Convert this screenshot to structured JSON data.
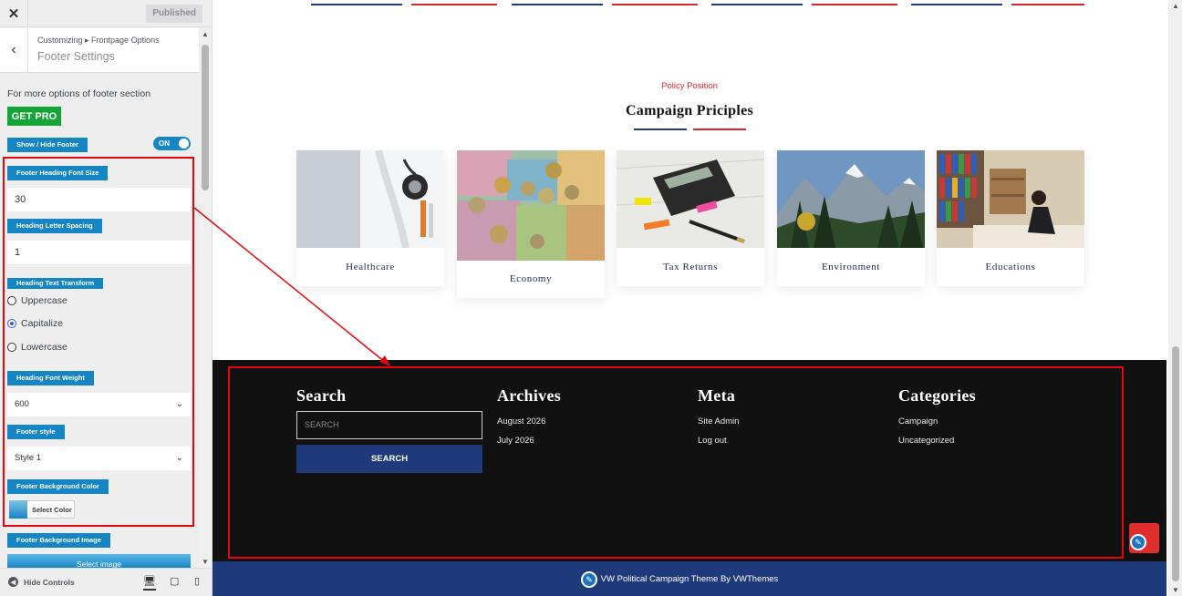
{
  "customizer": {
    "published_label": "Published",
    "breadcrumb": "Customizing ▸ Frontpage Options",
    "section_title": "Footer Settings",
    "more_options_text": "For more options of footer section",
    "get_pro_label": "GET PRO",
    "show_hide_label": "Show / Hide Footer",
    "toggle_label": "ON",
    "heading_font_size_label": "Footer Heading Font Size",
    "heading_font_size_value": "30",
    "letter_spacing_label": "Heading Letter Spacing",
    "letter_spacing_value": "1",
    "text_transform_label": "Heading Text Transform",
    "text_transform_options": [
      "Uppercase",
      "Capitalize",
      "Lowercase"
    ],
    "text_transform_selected": "Capitalize",
    "font_weight_label": "Heading Font Weight",
    "font_weight_value": "600",
    "footer_style_label": "Footer style",
    "footer_style_value": "Style 1",
    "bg_color_label": "Footer Background Color",
    "select_color_label": "Select Color",
    "bg_image_label": "Footer Background Image",
    "select_image_label": "Select image",
    "hide_controls_label": "Hide Controls"
  },
  "preview": {
    "policy_label": "Policy Position",
    "campaign_title": "Campaign Priciples",
    "cards": [
      {
        "label": "Healthcare",
        "icon": "doctor-stethoscope-image"
      },
      {
        "label": "Economy",
        "icon": "money-coins-image"
      },
      {
        "label": "Tax Returns",
        "icon": "calculator-image"
      },
      {
        "label": "Environment",
        "icon": "mountain-landscape-image"
      },
      {
        "label": "Educations",
        "icon": "office-binders-image"
      }
    ],
    "footer": {
      "search_title": "Search",
      "search_placeholder": "SEARCH",
      "search_button": "SEARCH",
      "archives_title": "Archives",
      "archives": [
        "August 2026",
        "July 2026"
      ],
      "meta_title": "Meta",
      "meta": [
        "Site Admin",
        "Log out"
      ],
      "categories_title": "Categories",
      "categories": [
        "Campaign",
        "Uncategorized"
      ]
    },
    "copyright": "VW Political Campaign Theme By VWThemes"
  },
  "colors": {
    "accent_blue": "#1585c4",
    "get_pro_green": "#13a538",
    "highlight_red": "#e4060c",
    "navy": "#1e3a7b",
    "footer_bg": "#111111"
  }
}
